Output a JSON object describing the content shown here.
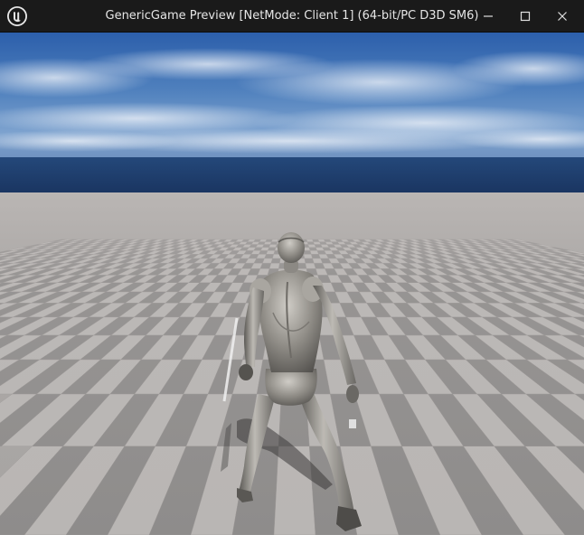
{
  "window": {
    "title": "GenericGame Preview [NetMode: Client 1]  (64-bit/PC D3D SM6)",
    "controls": {
      "minimize_icon": "minimize-icon",
      "maximize_icon": "maximize-icon",
      "close_icon": "close-icon"
    }
  },
  "colors": {
    "titlebar": "#1a1a1a",
    "title_text": "#e6e6e6",
    "sky_top": "#2a5ea8",
    "horizon_sea": "#1d3c68",
    "floor_light": "#b9b6b4",
    "floor_dark": "#8e8c8b"
  }
}
